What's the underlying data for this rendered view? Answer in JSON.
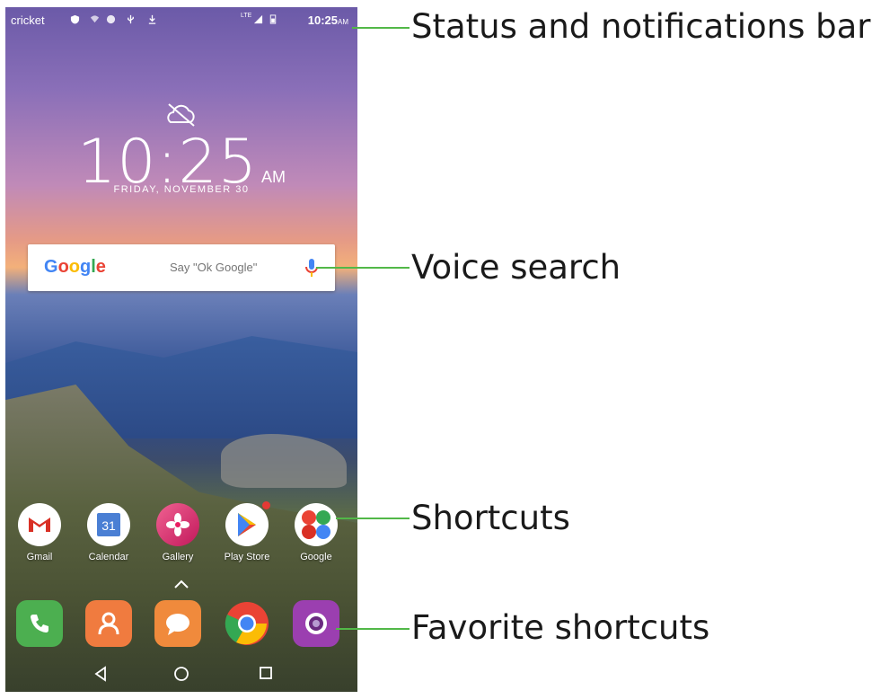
{
  "status_bar": {
    "carrier": "cricket",
    "network": "LTE",
    "time": "10:25",
    "ampm": "AM"
  },
  "lock_clock": {
    "time": "10:25",
    "ampm": "AM",
    "date": "FRIDAY, NOVEMBER 30"
  },
  "search": {
    "logo": "Google",
    "hint": "Say \"Ok Google\"",
    "colors": {
      "blue": "#4285F4",
      "red": "#EA4335",
      "yellow": "#FBBC05",
      "green": "#34A853"
    }
  },
  "shortcuts": [
    {
      "label": "Gmail",
      "icon": "gmail-icon",
      "color": "#ffffff"
    },
    {
      "label": "Calendar",
      "icon": "calendar-icon",
      "color": "#ffffff",
      "day": "31"
    },
    {
      "label": "Gallery",
      "icon": "gallery-icon",
      "color": "#e94b8c"
    },
    {
      "label": "Play Store",
      "icon": "play-store-icon",
      "color": "#ffffff"
    },
    {
      "label": "Google",
      "icon": "google-folder-icon",
      "color": "#ffffff"
    }
  ],
  "favorites": [
    {
      "icon": "phone-icon",
      "color": "#4caf50"
    },
    {
      "icon": "contacts-icon",
      "color": "#f07b3f"
    },
    {
      "icon": "messages-icon",
      "color": "#f08a3c"
    },
    {
      "icon": "chrome-icon",
      "color": "#ffffff"
    },
    {
      "icon": "camera-icon",
      "color": "#9b3fb0"
    }
  ],
  "callouts": {
    "status": "Status and notifications bar",
    "voice": "Voice search",
    "shortcuts": "Shortcuts",
    "favorites": "Favorite shortcuts"
  },
  "accent_color": "#52b848"
}
